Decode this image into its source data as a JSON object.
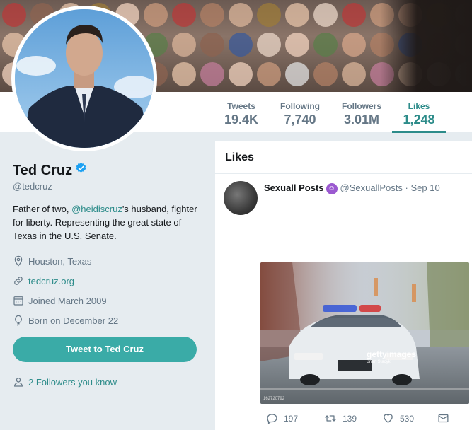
{
  "profile": {
    "name": "Ted Cruz",
    "handle": "@tedcruz",
    "bio_prefix": "Father of two, ",
    "bio_link": "@heidiscruz",
    "bio_suffix": "'s husband, fighter for liberty. Representing the great state of Texas in the U.S. Senate.",
    "location": "Houston, Texas",
    "website": "tedcruz.org",
    "joined": "Joined March 2009",
    "born": "Born on December 22",
    "tweet_to_label": "Tweet to Ted Cruz",
    "followers_you_know": "2 Followers you know"
  },
  "stats": [
    {
      "label": "Tweets",
      "value": "19.4K"
    },
    {
      "label": "Following",
      "value": "7,740"
    },
    {
      "label": "Followers",
      "value": "3.01M"
    },
    {
      "label": "Likes",
      "value": "1,248"
    }
  ],
  "timeline": {
    "title": "Likes",
    "tweet": {
      "user_name": "Sexuall Posts",
      "emoji": "smiling-imp-emoji",
      "handle": "@SexuallPosts",
      "separator": " · ",
      "date": "Sep 10",
      "media_watermark": "gettyimages",
      "media_credit": "Brian Stacyk",
      "media_id": "162720792",
      "replies": "197",
      "retweets": "139",
      "likes": "530"
    }
  },
  "icons": {
    "verified": "verified-badge-icon",
    "location": "location-pin-icon",
    "link": "link-icon",
    "calendar": "calendar-icon",
    "birthday": "balloon-icon",
    "followers": "person-icon",
    "reply": "reply-icon",
    "retweet": "retweet-icon",
    "like": "heart-icon",
    "dm": "envelope-icon"
  },
  "colors": {
    "accent": "#2d8c8a",
    "button": "#3aaba7",
    "verified": "#1da1f2"
  }
}
